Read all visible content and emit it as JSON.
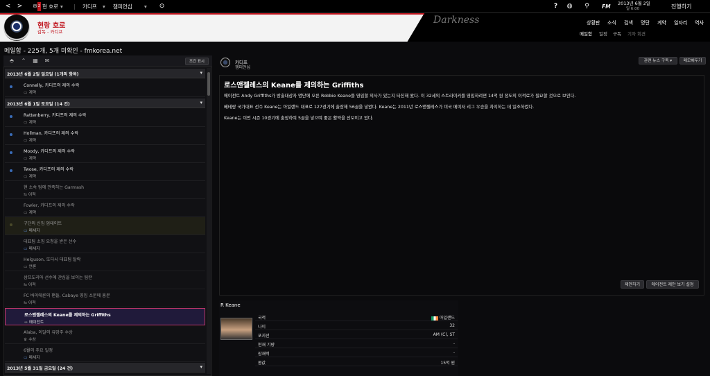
{
  "topbar": {
    "club_menu": "현 호로",
    "club_menu_badge": "2",
    "nav_club": "카디프",
    "nav_league": "챔피언십",
    "date": "2013년 6월 2일",
    "time": "일 6:00",
    "fm_label": "FM",
    "continue": "진행하기"
  },
  "header": {
    "club_name": "현랑 호로",
    "club_subtitle": "감독 - 카디프",
    "watermark": "Darkness",
    "nav_main": [
      "상황판",
      "소식",
      "검색",
      "명단",
      "계약",
      "일자리",
      "역사"
    ],
    "nav_sub": [
      "메일함",
      "일정",
      "구독",
      "기자 회견"
    ]
  },
  "page_title": "메일함 - 225개, 5개 미확인 - fmkorea.net",
  "left": {
    "filter_button": "조건 표시",
    "groups": [
      {
        "title": "2013년 6월 2일 일요일 (1개의 항목)"
      },
      {
        "title": "2013년 6월 1일 토요일 (14 건)"
      },
      {
        "title": "2013년 5월 31일 금요일 (24 건)"
      }
    ],
    "items": [
      {
        "title": "Connelly, 카디프의 제의 수락",
        "sub": "계약",
        "icon": "▭"
      },
      {
        "title": "Rattenberry, 카디프의 제의 수락",
        "sub": "계약",
        "icon": "▭"
      },
      {
        "title": "Hollman, 카디프의 제의 수락",
        "sub": "계약",
        "icon": "▭"
      },
      {
        "title": "Moody, 카디프의 제의 수락",
        "sub": "계약",
        "icon": "▭"
      },
      {
        "title": "Twose, 카디프의 제의 수락",
        "sub": "계약",
        "icon": "▭"
      },
      {
        "title": "현 소속 팀에 만족하는 Garmash",
        "sub": "이적",
        "icon": "⇆"
      },
      {
        "title": "Fowler, 카디프의 제의 수락",
        "sub": "계약",
        "icon": "▭"
      },
      {
        "title": "구단의 신임 업데이트",
        "sub": "메세지",
        "icon": "▭"
      },
      {
        "title": "대표팀 소집 요청을 받은 선수",
        "sub": "메세지",
        "icon": "▭"
      },
      {
        "title": "Helguson, 또다시 대표팀 탈락",
        "sub": "언론",
        "icon": "▭"
      },
      {
        "title": "삼프도리아 선수에 관심을 보이는 팀란",
        "sub": "이적",
        "icon": "⇆"
      },
      {
        "title": "FC 바이에른의 팬들, Cabaye 영입 소문에 흥분",
        "sub": "이적",
        "icon": "⇆"
      },
      {
        "title": "로스앤젤레스의 Keane를 제의하는 Griffiths",
        "sub": "에이전트",
        "icon": "↔"
      },
      {
        "title": "Alaba, 이달의 유망주 수상",
        "sub": "수상",
        "icon": "♛"
      },
      {
        "title": "6월의 주요 일정",
        "sub": "메세지",
        "icon": "▭"
      }
    ]
  },
  "message": {
    "club": "카디프",
    "competition": "챔피언십",
    "related_news": "관련 뉴스 구독",
    "memo": "메모해두기",
    "heading": "로스앤젤레스의 Keane를 제의하는 Griffiths",
    "paragraphs": [
      "에이전트 Andy Griffiths가 방출대상자 명단에 오른 Robbie Keane를 영입할 의사가 있는지 타진해 왔다. 이 32세의 스트라이커를 영입하려면 14억 원 정도의 이적료가 필요할 것으로 보인다.",
      "베테랑 국가대표 선수 Keane는 아일랜드 대표로 127경기에 출장해 56골을 넣었다. Keane는 2011년 로스앤젤레스가 미국 메이저 리그 우승을 차지하는 데 일조하였다.",
      "Keane는 이번 시즌 10경기에 출장하여 5골을 넣으며 좋은 활약을 선보이고 있다."
    ],
    "offer_btn": "제안하기",
    "agent_btn": "에이전트 제안 보기 설정"
  },
  "player": {
    "name": "R Keane",
    "rows": [
      {
        "label": "국적",
        "value": "아일랜드"
      },
      {
        "label": "나이",
        "value": "32"
      },
      {
        "label": "포지션",
        "value": "AM (C), ST"
      },
      {
        "label": "현재 기량",
        "value": "-"
      },
      {
        "label": "잠재력",
        "value": "-"
      },
      {
        "label": "몸값",
        "value": "15억 원"
      }
    ]
  }
}
